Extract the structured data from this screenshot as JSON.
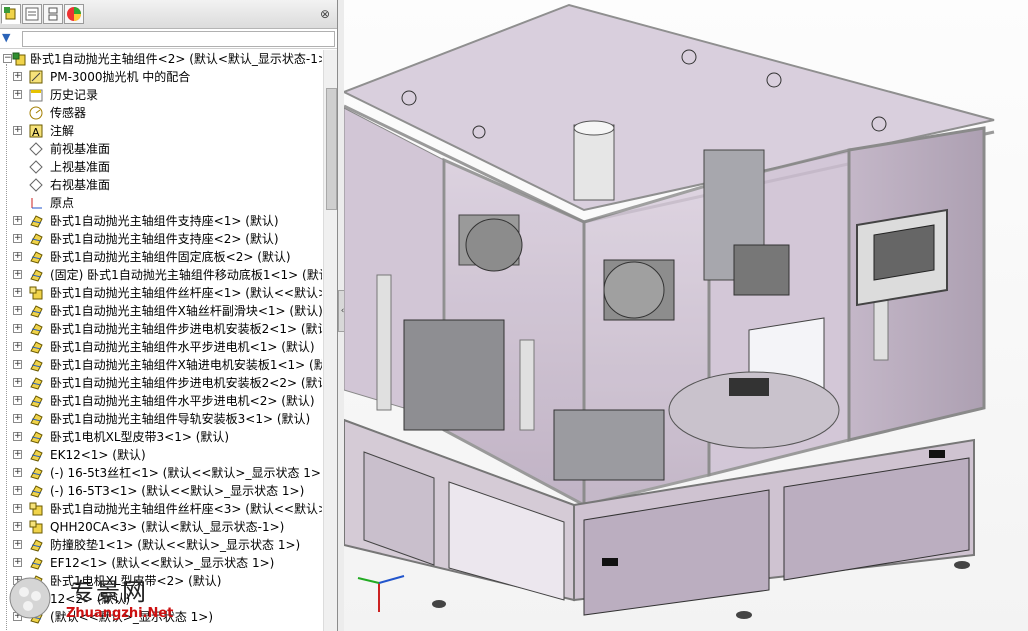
{
  "tree": {
    "items": [
      {
        "label": "卧式1自动抛光主轴组件<2> (默认<默认_显示状态-1>",
        "icon": "assembly-icon",
        "level": 0,
        "expand": "minus"
      },
      {
        "label": "PM-3000抛光机 中的配合",
        "icon": "mates-icon",
        "level": 1,
        "expand": "plus"
      },
      {
        "label": "历史记录",
        "icon": "history-icon",
        "level": 1,
        "expand": "plus"
      },
      {
        "label": "传感器",
        "icon": "sensor-icon",
        "level": 1,
        "expand": "none"
      },
      {
        "label": "注解",
        "icon": "annotation-icon",
        "level": 1,
        "expand": "plus"
      },
      {
        "label": "前视基准面",
        "icon": "plane-icon",
        "level": 1,
        "expand": "none"
      },
      {
        "label": "上视基准面",
        "icon": "plane-icon",
        "level": 1,
        "expand": "none"
      },
      {
        "label": "右视基准面",
        "icon": "plane-icon",
        "level": 1,
        "expand": "none"
      },
      {
        "label": "原点",
        "icon": "origin-icon",
        "level": 1,
        "expand": "none"
      },
      {
        "label": "卧式1自动抛光主轴组件支持座<1> (默认)",
        "icon": "part-icon",
        "level": 1,
        "expand": "plus"
      },
      {
        "label": "卧式1自动抛光主轴组件支持座<2> (默认)",
        "icon": "part-icon",
        "level": 1,
        "expand": "plus"
      },
      {
        "label": "卧式1自动抛光主轴组件固定底板<2> (默认)",
        "icon": "part-icon",
        "level": 1,
        "expand": "plus"
      },
      {
        "label": "(固定) 卧式1自动抛光主轴组件移动底板1<1> (默认",
        "icon": "part-icon",
        "level": 1,
        "expand": "plus"
      },
      {
        "label": "卧式1自动抛光主轴组件丝杆座<1> (默认<<默认>_",
        "icon": "subassembly-icon",
        "level": 1,
        "expand": "plus"
      },
      {
        "label": "卧式1自动抛光主轴组件X轴丝杆副滑块<1> (默认)",
        "icon": "part-icon",
        "level": 1,
        "expand": "plus"
      },
      {
        "label": "卧式1自动抛光主轴组件步进电机安装板2<1> (默认",
        "icon": "part-icon",
        "level": 1,
        "expand": "plus"
      },
      {
        "label": "卧式1自动抛光主轴组件水平步进电机<1> (默认)",
        "icon": "part-icon",
        "level": 1,
        "expand": "plus"
      },
      {
        "label": "卧式1自动抛光主轴组件X轴进电机安装板1<1> (默",
        "icon": "part-icon",
        "level": 1,
        "expand": "plus"
      },
      {
        "label": "卧式1自动抛光主轴组件步进电机安装板2<2> (默认",
        "icon": "part-icon",
        "level": 1,
        "expand": "plus"
      },
      {
        "label": "卧式1自动抛光主轴组件水平步进电机<2> (默认)",
        "icon": "part-icon",
        "level": 1,
        "expand": "plus"
      },
      {
        "label": "卧式1自动抛光主轴组件导轨安装板3<1> (默认)",
        "icon": "part-icon",
        "level": 1,
        "expand": "plus"
      },
      {
        "label": "卧式1电机XL型皮带3<1> (默认)",
        "icon": "part-icon",
        "level": 1,
        "expand": "plus"
      },
      {
        "label": "EK12<1> (默认)",
        "icon": "part-icon",
        "level": 1,
        "expand": "plus"
      },
      {
        "label": "(-) 16-5t3丝杠<1> (默认<<默认>_显示状态 1>)",
        "icon": "part-icon",
        "level": 1,
        "expand": "plus"
      },
      {
        "label": "(-) 16-5T3<1> (默认<<默认>_显示状态 1>)",
        "icon": "part-icon",
        "level": 1,
        "expand": "plus"
      },
      {
        "label": "卧式1自动抛光主轴组件丝杆座<3> (默认<<默认>_",
        "icon": "subassembly-icon",
        "level": 1,
        "expand": "plus"
      },
      {
        "label": "QHH20CA<3> (默认<默认_显示状态-1>)",
        "icon": "subassembly-icon",
        "level": 1,
        "expand": "plus"
      },
      {
        "label": "防撞胶垫1<1> (默认<<默认>_显示状态 1>)",
        "icon": "part-icon",
        "level": 1,
        "expand": "plus"
      },
      {
        "label": "EF12<1> (默认<<默认>_显示状态 1>)",
        "icon": "part-icon",
        "level": 1,
        "expand": "plus"
      },
      {
        "label": "卧式1电机XL型皮带<2> (默认)",
        "icon": "part-icon",
        "level": 1,
        "expand": "plus"
      },
      {
        "label": "12<2> (默认)",
        "icon": "part-icon",
        "level": 1,
        "expand": "plus"
      },
      {
        "label": "(默认<<默认>_显示状态 1>)",
        "icon": "part-icon",
        "level": 1,
        "expand": "plus"
      }
    ]
  },
  "watermark": {
    "cn": "专景网",
    "en": "Zhuangzhi.Net"
  },
  "colors": {
    "glass": "#c9b8cf",
    "frame": "#b9b9b9",
    "base": "#bfb2c2",
    "cabinet": "#d0c6d0"
  }
}
